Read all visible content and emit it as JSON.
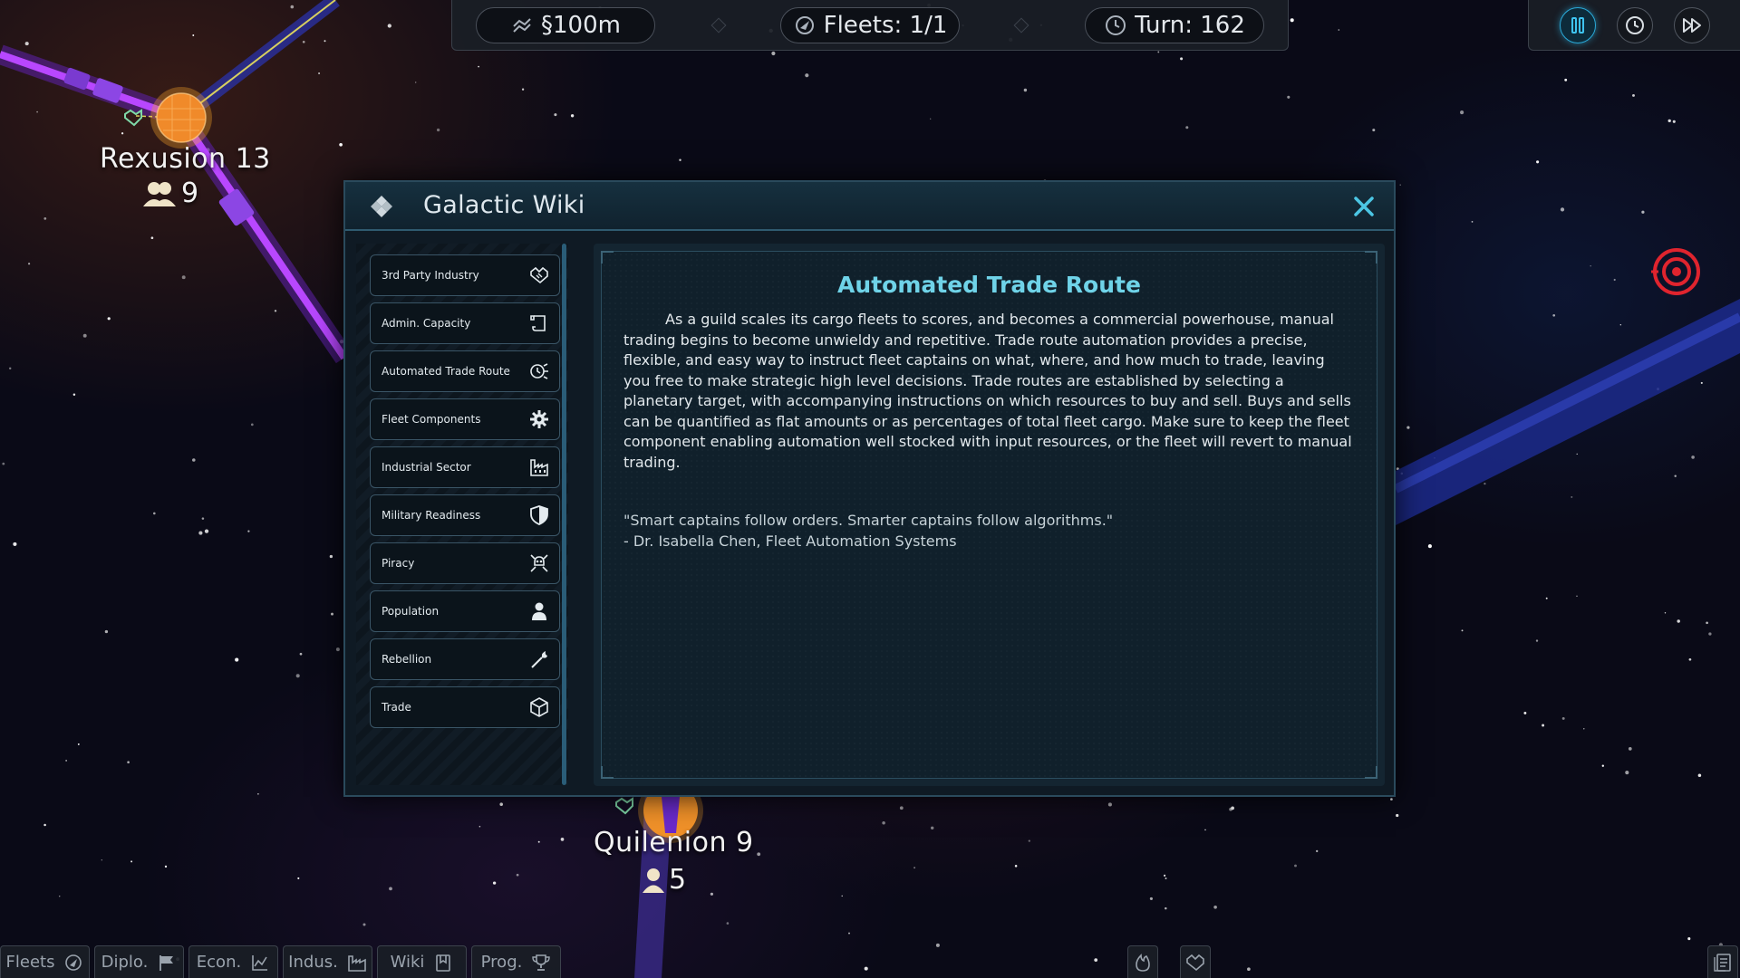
{
  "top_bar": {
    "credits": "§100m",
    "fleets": "Fleets: 1/1",
    "turn": "Turn: 162"
  },
  "speed_controls": [
    {
      "name": "pause",
      "icon": "pause-icon",
      "active": true
    },
    {
      "name": "normal",
      "icon": "clock-icon",
      "active": false
    },
    {
      "name": "fast",
      "icon": "fast-forward-icon",
      "active": false
    }
  ],
  "planets": [
    {
      "name": "Rexusion 13",
      "population": "9"
    },
    {
      "name": "Quilenion 9",
      "population": "5"
    }
  ],
  "wiki": {
    "title": "Galactic Wiki",
    "entries": [
      {
        "label": "3rd Party Industry",
        "icon": "handshake-icon"
      },
      {
        "label": "Admin. Capacity",
        "icon": "scroll-icon"
      },
      {
        "label": "Automated Trade Route",
        "icon": "automation-icon"
      },
      {
        "label": "Fleet Components",
        "icon": "gear-icon"
      },
      {
        "label": "Industrial Sector",
        "icon": "factory-icon"
      },
      {
        "label": "Military Readiness",
        "icon": "shield-icon"
      },
      {
        "label": "Piracy",
        "icon": "skull-crossbones-icon"
      },
      {
        "label": "Population",
        "icon": "person-icon"
      },
      {
        "label": "Rebellion",
        "icon": "torch-icon"
      },
      {
        "label": "Trade",
        "icon": "cargo-box-icon"
      }
    ],
    "article": {
      "title": "Automated Trade Route",
      "body": "As a guild scales its cargo fleets to scores, and becomes a commercial powerhouse, manual trading begins to become unwieldy and repetitive. Trade route automation provides a precise, flexible, and easy way to instruct fleet captains on what, where, and how much to trade, leaving you free to make strategic high level decisions. Trade routes are established by selecting a planetary target, with accompanying instructions on which resources to buy and sell. Buys and sells can be quantified as flat amounts or as percentages of total fleet cargo. Make sure to keep the fleet component enabling automation well stocked with input resources, or the fleet will revert to manual trading.",
      "quote": "\"Smart captains follow orders. Smarter captains follow algorithms.\"",
      "quote_author": "- Dr. Isabella Chen, Fleet Automation Systems"
    }
  },
  "bottom_tabs": [
    {
      "label": "Fleets",
      "icon": "fleet-icon"
    },
    {
      "label": "Diplo.",
      "icon": "flag-icon"
    },
    {
      "label": "Econ.",
      "icon": "chart-icon"
    },
    {
      "label": "Indus.",
      "icon": "factory-icon"
    },
    {
      "label": "Wiki",
      "icon": "book-icon"
    },
    {
      "label": "Prog.",
      "icon": "trophy-icon"
    }
  ],
  "colors": {
    "accent_cyan": "#6fd3e8",
    "trade_lane": "#a13cf0",
    "planet": "#f08a2a",
    "hostile_marker": "#e0242e"
  }
}
